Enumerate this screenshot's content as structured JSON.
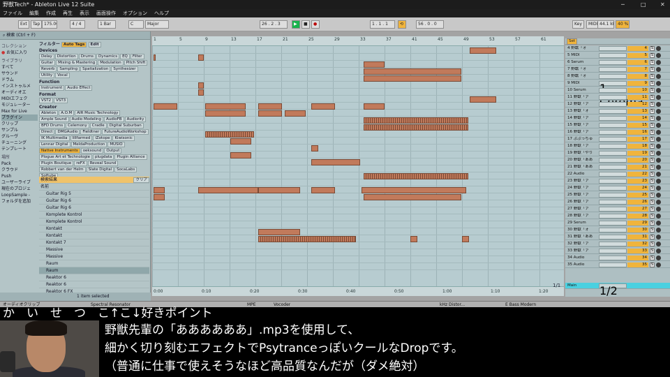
{
  "window": {
    "title": "野獣Tech* - Ableton Live 12 Suite"
  },
  "menu": [
    "ファイル",
    "編集",
    "作成",
    "再生",
    "表示",
    "画面操作",
    "オプション",
    "ヘルプ"
  ],
  "transport": {
    "ext": "Ext",
    "tap": "Tap",
    "tempo": "175.00",
    "sig": "4 / 4",
    "quant": "1 Bar",
    "key": "C",
    "scale": "Major",
    "position": "26 . 2 . 3",
    "loop_start": "1 . 1 . 1",
    "loop_len": "56 . 0 . 0",
    "key_btn": "Key",
    "midi_btn": "MIDI",
    "sample_rate": "44.1 kHz",
    "cpu": "40 %"
  },
  "browser": {
    "search_placeholder": "検索 (Ctrl + F)",
    "collections_title": "コレクション",
    "favorites": "お気に入り",
    "library_title": "ライブラリ",
    "places_items": [
      "すべて",
      "サウンド",
      "ドラム",
      "インストゥルメ",
      "オーディオエ",
      "MIDIエフェク",
      "モジュレーター",
      "Max for Live",
      "プラグイン",
      "クリップ",
      "サンプル",
      "グルーヴ",
      "チューニング",
      "テンプレート"
    ],
    "locations_title": "場所",
    "locations": [
      "Pack",
      "クラウド",
      "Push",
      "ユーザーライブ",
      "現在のプロジェ",
      "LoopSample -",
      "フォルダを追加"
    ],
    "filter_label": "フィルター",
    "auto_tags": "Auto Tags",
    "edit_btn": "Edit",
    "devices_title": "Devices",
    "device_chips": [
      "Delay",
      "Distortion",
      "Drums",
      "Dynamics",
      "EQ",
      "Filter",
      "Guitar",
      "Mixing & Mastering",
      "Modulation",
      "Pitch Shift",
      "Reverb",
      "Sampling",
      "Spatialization",
      "Synthesizer",
      "Utility",
      "Vocal"
    ],
    "function_title": "Function",
    "function_chips": [
      "Instrument",
      "Audio Effect"
    ],
    "format_title": "Format",
    "format_chips": [
      "VST2",
      "VST3"
    ],
    "creator_title": "Creator",
    "creator_chips": [
      "Ableton",
      "A.O.M",
      "AIR Music Technology",
      "Ample Sound",
      "Audio Modeling",
      "AudioFB",
      "Audiority",
      "BFD Drums",
      "Celemony",
      "Cradle",
      "Digital Suburban",
      "Direct",
      "DMGAudio",
      "Fieldtner",
      "FutureAudioWorkshop",
      "IK Multimedia",
      "lillfarmed",
      "iZotope",
      "Kiwisonic",
      "Lennar Digital",
      "MeldaProduction",
      "MUSIO",
      "Native Instruments",
      "oeksound",
      "Output",
      "Plogue Art et Technologie",
      "plugdata",
      "Plugin Alliance",
      "Plugin Boutique",
      "reFX",
      "Reveal Sound",
      "Robbert van der Helm",
      "Slate Digital",
      "SocaLabs",
      "Softube"
    ],
    "results_label": "検索結果",
    "clear_btn": "クリア",
    "name_header": "名前",
    "items": [
      "Guitar Rig 5",
      "Guitar Rig 6",
      "Guitar Rig 6",
      "Komplete Kontrol",
      "Komplete Kontrol",
      "Kontakt",
      "Kontakt",
      "Kontakt 7",
      "Massive",
      "Massive",
      "Raum",
      "Raum",
      "Reaktor 6",
      "Reaktor 6",
      "Reaktor 6 FX"
    ],
    "status": "1 item selected"
  },
  "arrangement": {
    "ruler": [
      "1",
      "5",
      "9",
      "13",
      "17",
      "21",
      "25",
      "29",
      "33",
      "37",
      "41",
      "45",
      "49",
      "53",
      "57",
      "61"
    ],
    "times": [
      "0:00",
      "0:10",
      "0:20",
      "0:30",
      "0:40",
      "0:50",
      "1:00",
      "1:10",
      "1:20"
    ],
    "zoom": "1/1"
  },
  "tracks": [
    {
      "n": "4",
      "name": "4 野獣「ォ"
    },
    {
      "n": "5",
      "name": "5 MIDI"
    },
    {
      "n": "6",
      "name": "6 Serum"
    },
    {
      "n": "7",
      "name": "7 野獣「ォ"
    },
    {
      "n": "8",
      "name": "8 野獣「ォ"
    },
    {
      "n": "9",
      "name": "9 MIDI",
      "sel": "1-Chroma"
    },
    {
      "n": "10",
      "name": "10 Serum"
    },
    {
      "n": "11",
      "name": "11 野獣「ァ"
    },
    {
      "n": "12",
      "name": "12 野獣「ァ"
    },
    {
      "n": "13",
      "name": "13 野獣「ォ"
    },
    {
      "n": "14",
      "name": "14 野獣「ァ"
    },
    {
      "n": "15",
      "name": "15 野獣「ァ"
    },
    {
      "n": "16",
      "name": "16 野獣「ァ"
    },
    {
      "n": "17",
      "name": "17 ぷぷっちゅ"
    },
    {
      "n": "18",
      "name": "18 野獣「ァ"
    },
    {
      "n": "19",
      "name": "19 野獣「やり"
    },
    {
      "n": "20",
      "name": "20 野獣「ああ"
    },
    {
      "n": "21",
      "name": "21 野獣「ああ"
    },
    {
      "n": "22",
      "name": "22 Audio"
    },
    {
      "n": "23",
      "name": "23 野獣「ァ"
    },
    {
      "n": "24",
      "name": "24 野獣「ァ"
    },
    {
      "n": "25",
      "name": "25 野獣「ァ"
    },
    {
      "n": "26",
      "name": "26 野獣「ァ"
    },
    {
      "n": "27",
      "name": "27 野獣「ァ"
    },
    {
      "n": "28",
      "name": "28 野獣「ァ"
    },
    {
      "n": "29",
      "name": "29 Serum"
    },
    {
      "n": "30",
      "name": "30 野獣「ォ"
    },
    {
      "n": "31",
      "name": "31 野獣「ああ"
    },
    {
      "n": "32",
      "name": "32 野獣「ァ"
    },
    {
      "n": "33",
      "name": "33 野獣「ァ"
    },
    {
      "n": "34",
      "name": "34 Audio"
    },
    {
      "n": "35",
      "name": "35 Audio"
    }
  ],
  "master": {
    "name": "Main",
    "value": "1/2",
    "set_btn": "Set"
  },
  "devices": [
    "オーディオクリップ",
    "Spectral Resonator",
    "MPE",
    "Vocoder",
    "kHz Distor...",
    "E Bass Modern"
  ],
  "subtitles": {
    "line0": "か　い　せ　つ　こ↑こ↓好きポイント",
    "line1": "野獣先輩の「ああああああ」.mp3を使用して、",
    "line2": "細かく切り刻むエフェクトでPsytranceっぽいクールなDropです。",
    "line3": "（普通に仕事で使えそうなほど高品質なんだが（ダメ絶対）"
  },
  "colors": {
    "accent": "#f0b43c",
    "clip": "#c17a5b",
    "arrangement_bg": "#b7ccd0",
    "browser_bg": "#b4c5c7",
    "play": "#19b34d"
  }
}
